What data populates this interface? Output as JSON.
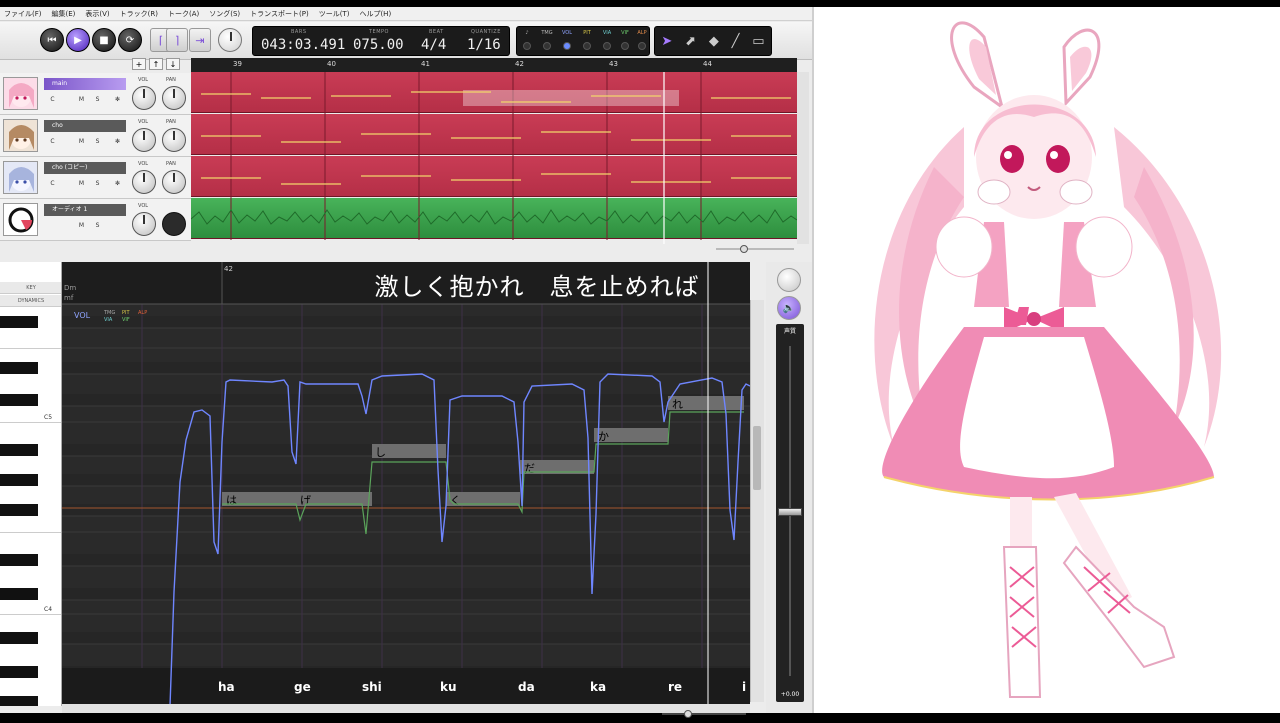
{
  "menu": [
    "ファイル(F)",
    "編集(E)",
    "表示(V)",
    "トラック(R)",
    "トーク(A)",
    "ソング(S)",
    "トランスポート(P)",
    "ツール(T)",
    "ヘルプ(H)"
  ],
  "transport": {
    "bars_label": "BARS",
    "bars": "043:03.491",
    "tempo_label": "TEMPO",
    "tempo": "075.00",
    "beat_label": "BEAT",
    "beat": "4/4",
    "quantize_label": "QUANTIZE",
    "quantize": "1/16"
  },
  "modes": [
    "TMG",
    "VOL",
    "PIT",
    "VIA",
    "VIF",
    "ALP"
  ],
  "tracks": [
    {
      "name": "main",
      "vol": "VOL",
      "pan": "PAN"
    },
    {
      "name": "cho",
      "vol": "VOL",
      "pan": "PAN"
    },
    {
      "name": "cho (コピー)",
      "vol": "VOL",
      "pan": "PAN"
    },
    {
      "name": "オーディオ 1",
      "vol": "VOL",
      "pan": ""
    }
  ],
  "track_buttons": {
    "c": "C",
    "m": "M",
    "s": "S",
    "fx": "✻"
  },
  "add_buttons": [
    "+",
    "↑",
    "↓"
  ],
  "timeline_ruler": [
    "39",
    "40",
    "41",
    "42",
    "43",
    "44"
  ],
  "roll": {
    "key_label": "KEY",
    "dynamics_label": "DYNAMICS",
    "key_value": "Dm",
    "dynamics_value": "mf",
    "ruler_bar": "42",
    "lyric_caption": "激しく抱かれ　息を止めれば",
    "param_tabs": [
      "VOL",
      "TMG",
      "PIT",
      "ALP",
      "VIA",
      "VIF"
    ],
    "note_c5": "C5",
    "note_c4": "C4"
  },
  "notes": [
    {
      "lyric": "は",
      "phoneme": "ha"
    },
    {
      "lyric": "げ",
      "phoneme": "ge"
    },
    {
      "lyric": "し",
      "phoneme": "shi"
    },
    {
      "lyric": "く",
      "phoneme": "ku"
    },
    {
      "lyric": "だ",
      "phoneme": "da"
    },
    {
      "lyric": "か",
      "phoneme": "ka"
    },
    {
      "lyric": "れ",
      "phoneme": "re"
    },
    {
      "lyric": "",
      "phoneme": "i"
    }
  ],
  "side": {
    "fader_title": "声質",
    "fader_value": "+0.00"
  },
  "colors": {
    "accent": "#7b56c9",
    "lane_song": "#c93c55",
    "lane_audio": "#3aa24c",
    "vol_curve": "#6f86ff",
    "pit_curve": "#5ba45b"
  }
}
